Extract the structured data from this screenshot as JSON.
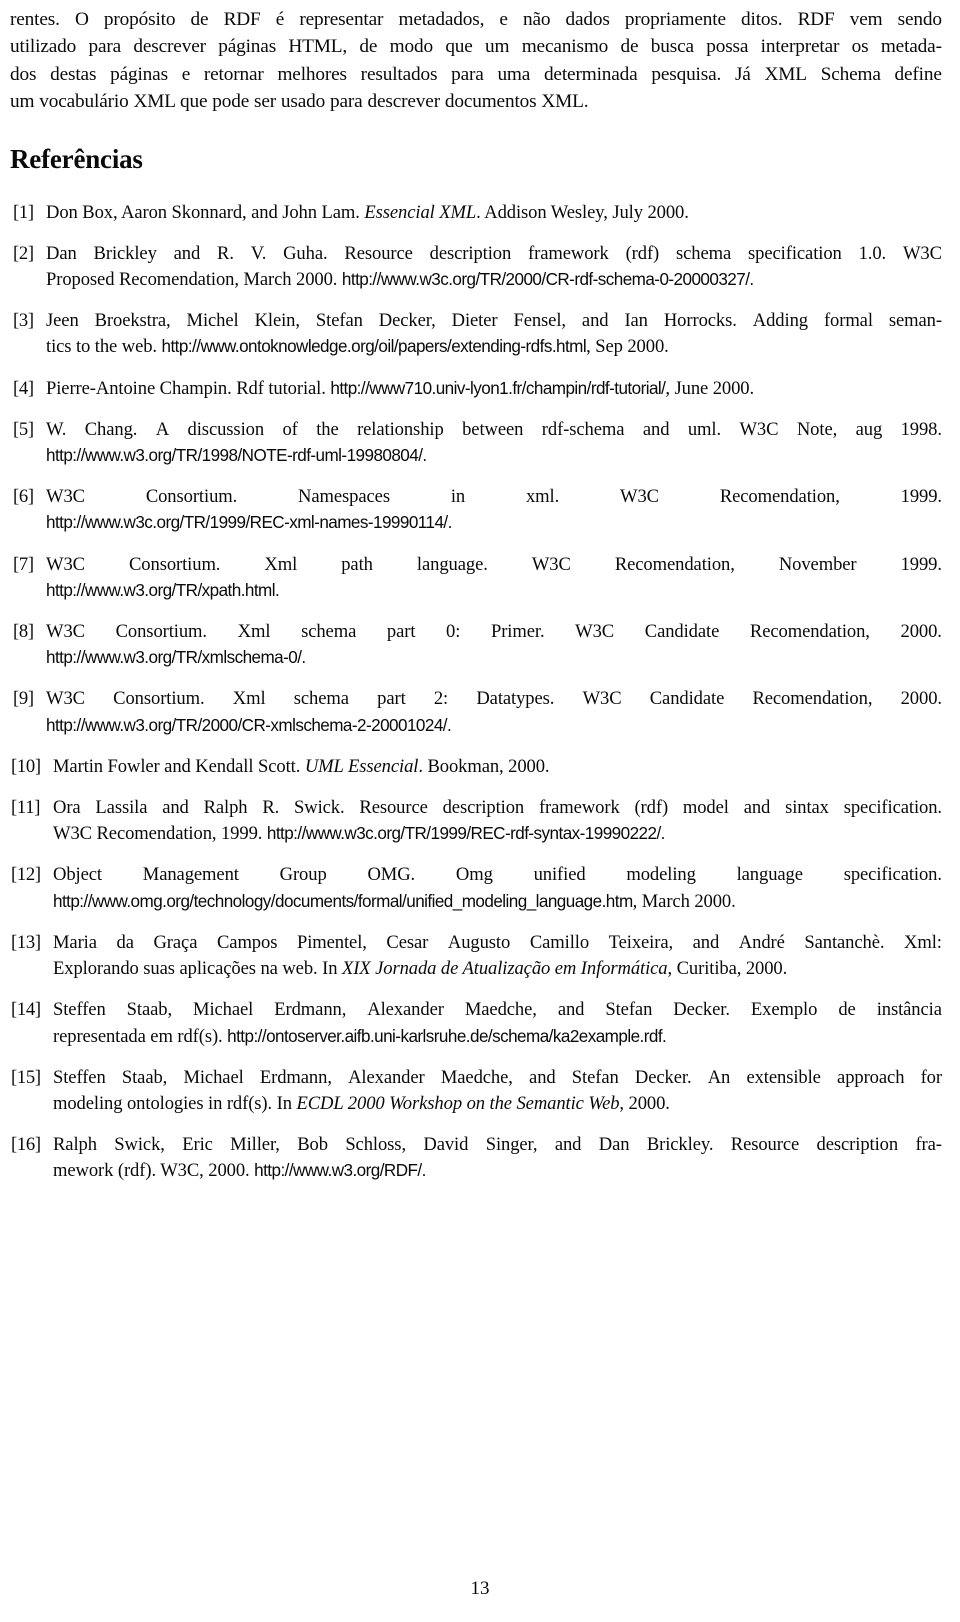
{
  "document": {
    "language": "pt-BR",
    "page_number": "13"
  },
  "body_paragraph": {
    "text": "rentes. O propósito de RDF é representar metadados, e não dados propriamente ditos. RDF vem sendo utilizado para descrever páginas HTML, de modo que um mecanismo de busca possa interpretar os metadados destas páginas e retornar melhores resultados para uma determinada pesquisa. Já XML Schema define um vocabulário XML que pode ser usado para descrever documentos XML.",
    "lines": [
      "rentes.  O propósito de RDF é representar metadados, e não dados propriamente ditos.  RDF vem sendo",
      "utilizado para descrever páginas HTML, de modo que um mecanismo de busca possa interpretar os metada-",
      "dos destas páginas e retornar melhores resultados para uma determinada pesquisa. Já XML Schema define",
      "um vocabulário XML que pode ser usado para descrever documentos XML."
    ]
  },
  "references_heading": "Referências",
  "references": [
    {
      "label": "[1]",
      "authors": "Don Box, Aaron Skonnard, and John Lam.",
      "title_italic": "Essencial XML",
      "rest": ". Addison Wesley, July 2000.",
      "line1_a": "Don Box, Aaron Skonnard, and John Lam. ",
      "line1_italic": "Essencial XML",
      "line1_b": ". Addison Wesley, July 2000."
    },
    {
      "label": "[2]",
      "line1": "Dan Brickley and R. V. Guha.  Resource description framework (rdf) schema specification 1.0.  W3C",
      "line2_a": "Proposed Recomendation, March 2000. ",
      "line2_url": "http://www.w3c.org/TR/2000/CR-rdf-schema-0-20000327/."
    },
    {
      "label": "[3]",
      "line1": "Jeen Broekstra, Michel Klein, Stefan Decker, Dieter Fensel, and Ian Horrocks. Adding formal seman-",
      "line2_a": "tics to the web. ",
      "line2_url": "http://www.ontoknowledge.org/oil/papers/extending-rdfs.html",
      "line2_b": ", Sep 2000."
    },
    {
      "label": "[4]",
      "line1_a": "Pierre-Antoine Champin. Rdf tutorial. ",
      "line1_url": "http://www710.univ-lyon1.fr/champin/rdf-tutorial/",
      "line1_b": ", June 2000."
    },
    {
      "label": "[5]",
      "line1": "W. Chang.   A discussion of the relationship between rdf-schema and uml.   W3C Note, aug 1998.",
      "line2_url": "http://www.w3.org/TR/1998/NOTE-rdf-uml-19980804/."
    },
    {
      "label": "[6]",
      "line1": "W3C  Consortium.        Namespaces  in  xml.       W3C  Recomendation,  1999.",
      "line1_words": [
        "W3C",
        "Consortium.",
        "Namespaces",
        "in",
        "xml.",
        "W3C",
        "Recomendation,",
        "1999."
      ],
      "line2_url": "http://www.w3c.org/TR/1999/REC-xml-names-19990114/."
    },
    {
      "label": "[7]",
      "line1_words": [
        "W3C",
        "Consortium.",
        "Xml",
        "path",
        "language.",
        "W3C",
        "Recomendation,",
        "November",
        "1999."
      ],
      "line2_url": "http://www.w3.org/TR/xpath.html."
    },
    {
      "label": "[8]",
      "line1_words": [
        "W3C",
        "Consortium.",
        "Xml",
        "schema",
        "part",
        "0:",
        "Primer.",
        "W3C",
        "Candidate",
        "Recomendation,",
        "2000."
      ],
      "line2_url": "http://www.w3.org/TR/xmlschema-0/."
    },
    {
      "label": "[9]",
      "line1_words": [
        "W3C",
        "Consortium.",
        "Xml",
        "schema",
        "part",
        "2:",
        "Datatypes.",
        "W3C",
        "Candidate",
        "Recomendation,",
        "2000."
      ],
      "line2_url": "http://www.w3.org/TR/2000/CR-xmlschema-2-20001024/."
    },
    {
      "label": "[10]",
      "line1_a": "Martin Fowler and Kendall Scott. ",
      "line1_italic": "UML Essencial",
      "line1_b": ". Bookman, 2000."
    },
    {
      "label": "[11]",
      "line1": "Ora Lassila and Ralph R. Swick. Resource description framework (rdf) model and sintax specification.",
      "line2_a": "W3C Recomendation, 1999. ",
      "line2_url": "http://www.w3c.org/TR/1999/REC-rdf-syntax-19990222/."
    },
    {
      "label": "[12]",
      "line1_words": [
        "Object",
        "Management",
        "Group",
        "OMG.",
        "Omg",
        "unified",
        "modeling",
        "language",
        "specification."
      ],
      "line2_url": "http://www.omg.org/technology/documents/formal/unified_modeling_language.htm",
      "line2_b": ", March 2000."
    },
    {
      "label": "[13]",
      "line1": "Maria da Graça Campos Pimentel, Cesar Augusto Camillo Teixeira, and André Santanchè.  Xml:",
      "line2_a": "Explorando suas aplicações na web. In ",
      "line2_italic": "XIX Jornada de Atualização em Informática",
      "line2_b": ", Curitiba, 2000."
    },
    {
      "label": "[14]",
      "line1": "Steffen Staab, Michael Erdmann, Alexander Maedche, and Stefan Decker.  Exemplo de instância",
      "line2_a": "representada em rdf(s). ",
      "line2_url": "http://ontoserver.aifb.uni-karlsruhe.de/schema/ka2example.rdf."
    },
    {
      "label": "[15]",
      "line1": "Steffen Staab, Michael Erdmann, Alexander Maedche, and Stefan Decker. An extensible approach for",
      "line2_a": "modeling ontologies in rdf(s). In ",
      "line2_italic": "ECDL 2000 Workshop on the Semantic Web",
      "line2_b": ", 2000."
    },
    {
      "label": "[16]",
      "line1": "Ralph Swick, Eric Miller, Bob Schloss, David Singer, and Dan Brickley.  Resource description fra-",
      "line2_a": "mework (rdf). W3C, 2000. ",
      "line2_url": "http://www.w3.org/RDF/."
    }
  ]
}
